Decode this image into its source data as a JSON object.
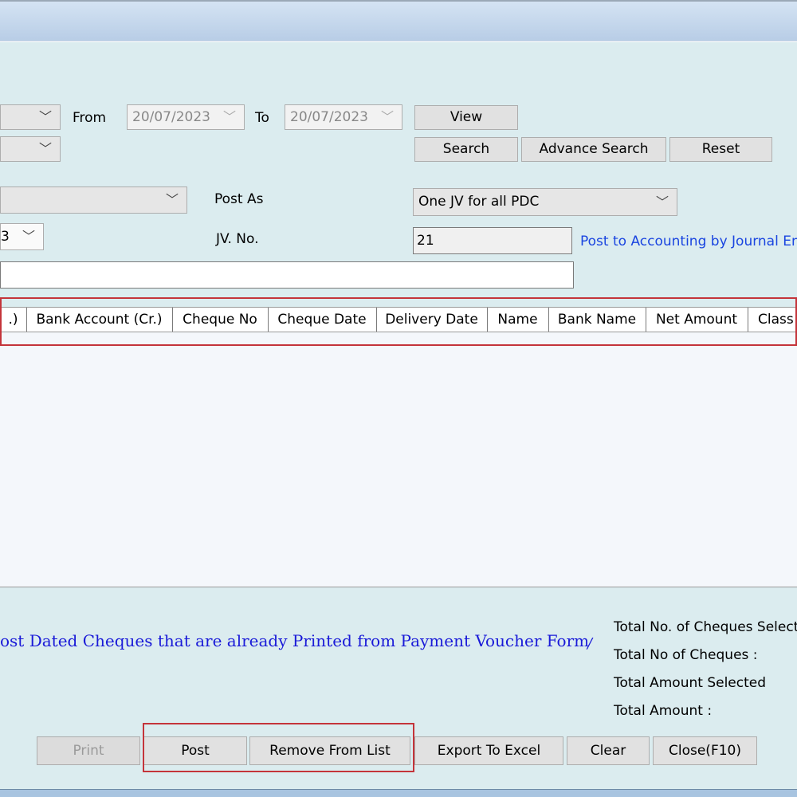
{
  "filters": {
    "combo1_value": "",
    "combo2_value": "",
    "combo3_value": "",
    "combo4_value": "3",
    "from_label": "From",
    "from_date": "20/07/2023",
    "to_label": "To",
    "to_date": "20/07/2023",
    "view_label": "View",
    "search_label": "Search",
    "advance_search_label": "Advance Search",
    "reset_label": "Reset"
  },
  "posting": {
    "post_as_label": "Post As",
    "post_as_value": "One JV for all PDC",
    "jv_no_label": "JV. No.",
    "jv_no_value": "21",
    "post_link": "Post to Accounting by Journal Ent",
    "remarks_value": ""
  },
  "grid": {
    "columns": [
      ".)",
      "Bank Account (Cr.)",
      "Cheque No",
      "Cheque Date",
      "Delivery Date",
      "Name",
      "Bank Name",
      "Net Amount",
      "Class"
    ],
    "rows": []
  },
  "footer": {
    "message": "ost Dated Cheques that are already Printed from Payment Voucher Form",
    "message_link": "/",
    "total_selected_label": "Total No. of Cheques  Select",
    "total_cheques_label": "Total No of Cheques :",
    "total_amount_selected_label": "Total Amount Selected",
    "total_amount_label": "Total Amount :"
  },
  "buttons": {
    "print": "Print",
    "post": "Post",
    "remove": "Remove From List",
    "export": "Export To Excel",
    "clear": "Clear",
    "close": "Close(F10)"
  },
  "icons": {
    "dropdown": "chevron-down-icon",
    "dropdown_glyph": "﹀"
  }
}
